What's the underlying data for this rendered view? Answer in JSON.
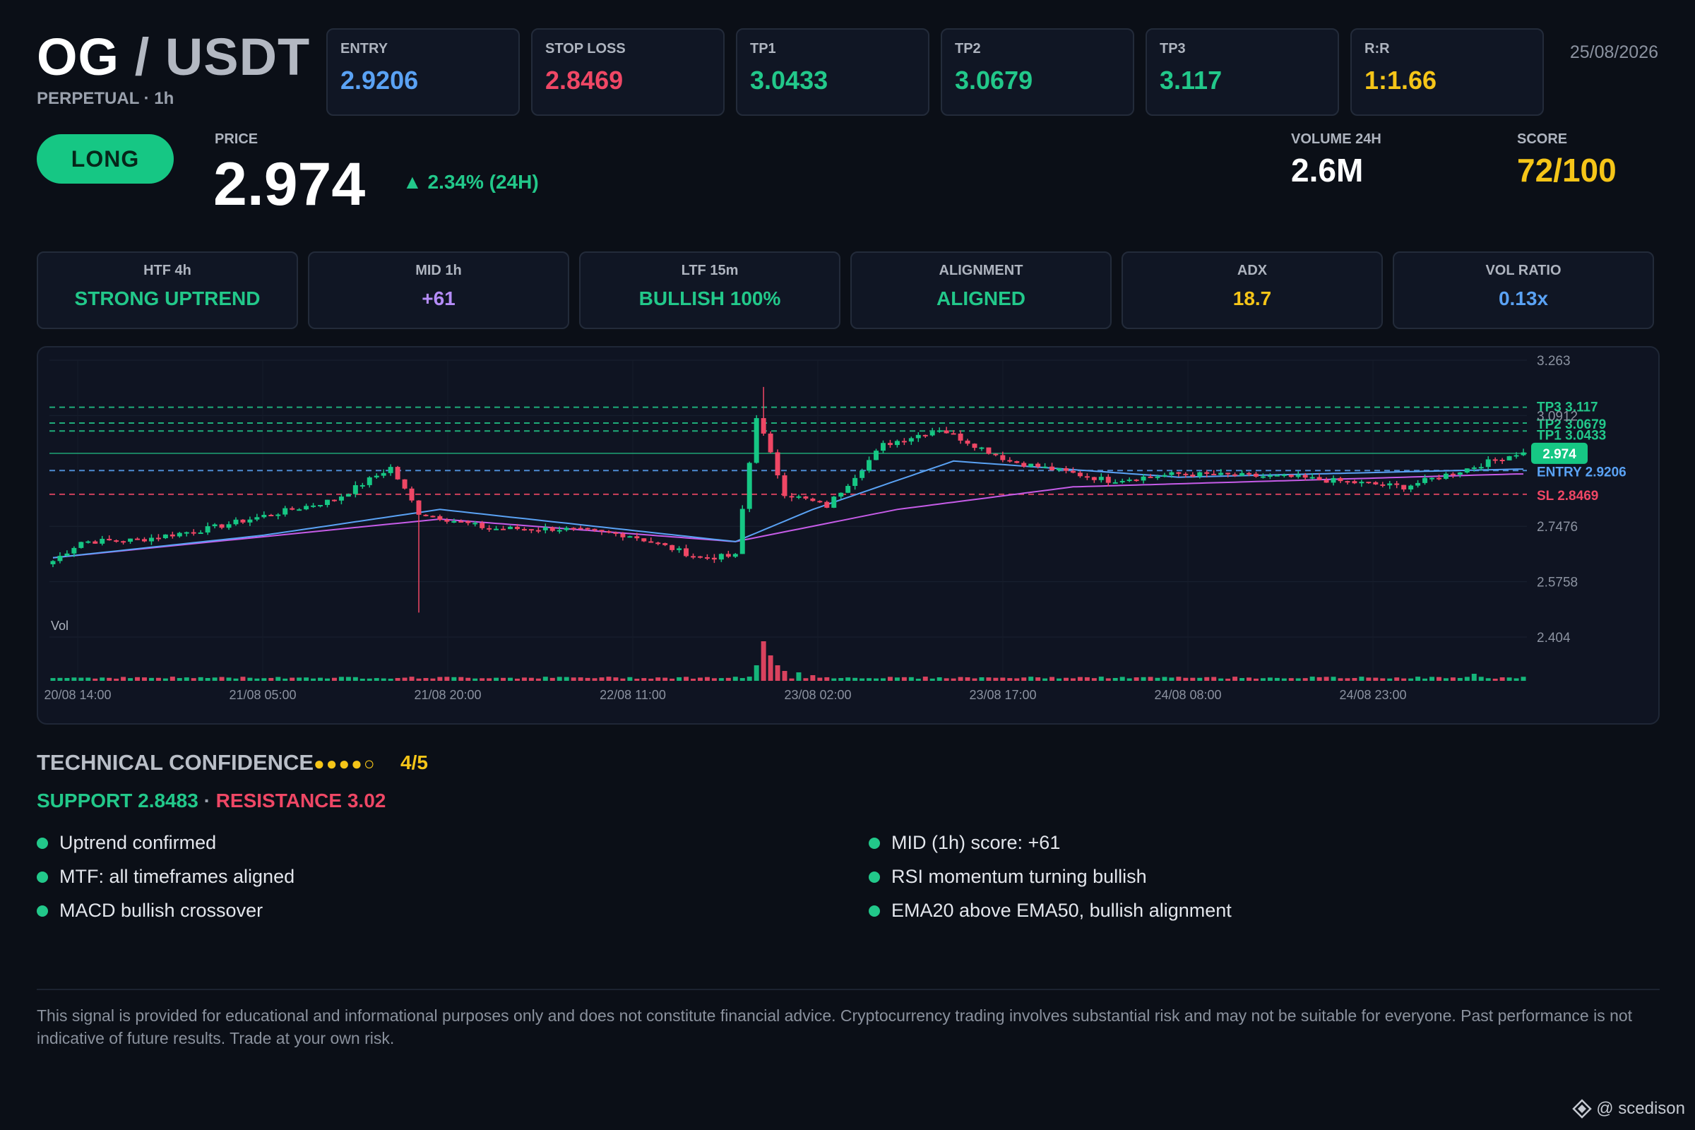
{
  "header": {
    "pair_base": "OG",
    "pair_sep": "/",
    "pair_quote": "USDT",
    "subtitle": "PERPETUAL · 1h",
    "date": "25/08/2026"
  },
  "metrics": [
    {
      "label": "ENTRY",
      "value": "2.9206",
      "color": "#5aa2f4"
    },
    {
      "label": "STOP LOSS",
      "value": "2.8469",
      "color": "#ef4765"
    },
    {
      "label": "TP1",
      "value": "3.0433",
      "color": "#22c88a"
    },
    {
      "label": "TP2",
      "value": "3.0679",
      "color": "#22c88a"
    },
    {
      "label": "TP3",
      "value": "3.117",
      "color": "#22c88a"
    },
    {
      "label": "R:R",
      "value": "1:1.66",
      "color": "#f5c518"
    }
  ],
  "signal": {
    "direction": "LONG",
    "price_label": "PRICE",
    "price": "2.974",
    "change": "▲ 2.34% (24H)",
    "volume_label": "VOLUME 24H",
    "volume": "2.6M",
    "score_label": "SCORE",
    "score": "72/100"
  },
  "indicators": [
    {
      "label": "HTF 4h",
      "value": "STRONG UPTREND",
      "color": "#22c88a"
    },
    {
      "label": "MID 1h",
      "value": "+61",
      "color": "#b58cf8"
    },
    {
      "label": "LTF 15m",
      "value": "BULLISH 100%",
      "color": "#22c88a"
    },
    {
      "label": "ALIGNMENT",
      "value": "ALIGNED",
      "color": "#22c88a"
    },
    {
      "label": "ADX",
      "value": "18.7",
      "color": "#f5c518"
    },
    {
      "label": "VOL RATIO",
      "value": "0.13x",
      "color": "#5aa2f4"
    }
  ],
  "chart_data": {
    "type": "candlestick",
    "ylim": [
      2.404,
      3.263
    ],
    "y_ticks": [
      "3.263",
      "3.0912",
      "2.7476",
      "2.5758",
      "2.404"
    ],
    "x_ticks": [
      "20/08 14:00",
      "21/08 05:00",
      "21/08 20:00",
      "22/08 11:00",
      "23/08 02:00",
      "23/08 17:00",
      "24/08 08:00",
      "24/08 23:00"
    ],
    "volume_label": "Vol",
    "current_price_tag": "2.974",
    "levels": [
      {
        "name": "TP3",
        "label": "TP3 3.117",
        "value": 3.117,
        "color": "#22c88a"
      },
      {
        "name": "TP2",
        "label": "TP2 3.0679",
        "value": 3.0679,
        "color": "#22c88a"
      },
      {
        "name": "TP1",
        "label": "TP1 3.0433",
        "value": 3.0433,
        "color": "#22c88a"
      },
      {
        "name": "ENTRY",
        "label": "ENTRY 2.9206",
        "value": 2.9206,
        "color": "#5aa2f4"
      },
      {
        "name": "SL",
        "label": "SL 2.8469",
        "value": 2.8469,
        "color": "#ef4765"
      }
    ],
    "close_anchors": [
      [
        0,
        2.64
      ],
      [
        4,
        2.7
      ],
      [
        12,
        2.705
      ],
      [
        22,
        2.74
      ],
      [
        30,
        2.78
      ],
      [
        40,
        2.83
      ],
      [
        48,
        2.93
      ],
      [
        52,
        2.79
      ],
      [
        62,
        2.74
      ],
      [
        72,
        2.74
      ],
      [
        82,
        2.72
      ],
      [
        92,
        2.65
      ],
      [
        97,
        2.655
      ],
      [
        100,
        3.09
      ],
      [
        104,
        2.85
      ],
      [
        110,
        2.81
      ],
      [
        118,
        3.0
      ],
      [
        126,
        3.05
      ],
      [
        136,
        2.95
      ],
      [
        150,
        2.89
      ],
      [
        160,
        2.91
      ],
      [
        176,
        2.9
      ],
      [
        192,
        2.87
      ],
      [
        200,
        2.92
      ],
      [
        208,
        2.974
      ]
    ],
    "ema_fast_anchors": [
      [
        0,
        2.65
      ],
      [
        30,
        2.72
      ],
      [
        55,
        2.8
      ],
      [
        97,
        2.7
      ],
      [
        108,
        2.8
      ],
      [
        128,
        2.95
      ],
      [
        160,
        2.9
      ],
      [
        208,
        2.925
      ]
    ],
    "ema_slow_anchors": [
      [
        0,
        2.65
      ],
      [
        55,
        2.77
      ],
      [
        97,
        2.7
      ],
      [
        120,
        2.8
      ],
      [
        145,
        2.87
      ],
      [
        208,
        2.91
      ]
    ]
  },
  "technical": {
    "title": "TECHNICAL CONFIDENCE",
    "dots": "●●●●○",
    "score": "4/5",
    "support": "SUPPORT 2.8483",
    "separator": "·",
    "resistance": "RESISTANCE 3.02",
    "bullets_left": [
      "Uptrend confirmed",
      "MTF: all timeframes aligned",
      "MACD bullish crossover"
    ],
    "bullets_right": [
      "MID (1h) score: +61",
      "RSI momentum turning bullish",
      "EMA20 above EMA50, bullish alignment"
    ]
  },
  "disclaimer": "This signal is provided for educational and informational purposes only and does not constitute financial advice. Cryptocurrency trading involves substantial risk and may not be suitable for everyone. Past performance is not indicative of future results. Trade at your own risk.",
  "watermark": "@ scedison"
}
